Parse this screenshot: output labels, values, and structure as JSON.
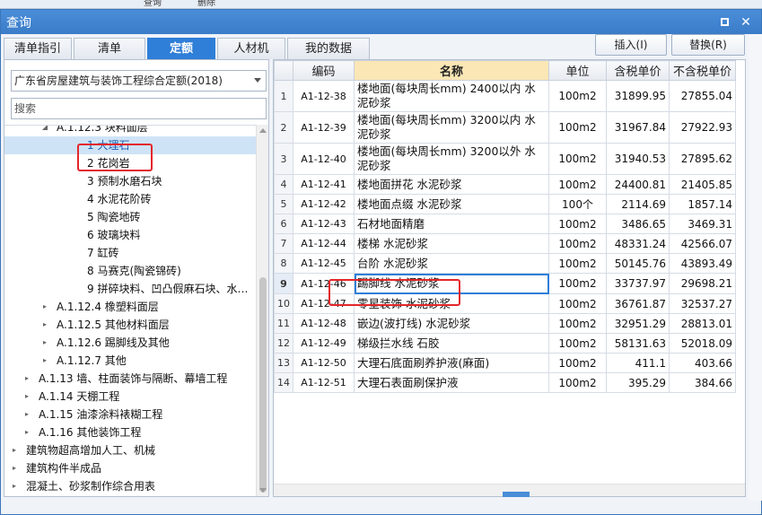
{
  "window": {
    "title": "查询"
  },
  "app_strip": {
    "items": [
      "查询",
      "删除"
    ]
  },
  "tabs": [
    {
      "label": "清单指引",
      "active": false
    },
    {
      "label": "清单",
      "active": false
    },
    {
      "label": "定额",
      "active": true
    },
    {
      "label": "人材机",
      "active": false
    },
    {
      "label": "我的数据",
      "active": false
    }
  ],
  "actions": {
    "insert_label": "插入(I)",
    "replace_label": "替换(R)"
  },
  "left": {
    "quota_library": "广东省房屋建筑与装饰工程综合定额(2018)",
    "search_placeholder": "搜索",
    "tree": [
      {
        "label": "A.1.12.3 块料面层",
        "level": 3,
        "expanded": true
      },
      {
        "label": "1 大理石",
        "level": 4,
        "selected": true
      },
      {
        "label": "2 花岗岩",
        "level": 4
      },
      {
        "label": "3 预制水磨石块",
        "level": 4
      },
      {
        "label": "4 水泥花阶砖",
        "level": 4
      },
      {
        "label": "5 陶瓷地砖",
        "level": 4
      },
      {
        "label": "6 玻璃块料",
        "level": 4
      },
      {
        "label": "7 缸砖",
        "level": 4
      },
      {
        "label": "8 马赛克(陶瓷锦砖)",
        "level": 4
      },
      {
        "label": "9 拼碎块料、凹凸假麻石块、水…",
        "level": 4
      },
      {
        "label": "A.1.12.4 橡塑料面层",
        "level": 3
      },
      {
        "label": "A.1.12.5 其他材料面层",
        "level": 3
      },
      {
        "label": "A.1.12.6 踢脚线及其他",
        "level": 3
      },
      {
        "label": "A.1.12.7 其他",
        "level": 3
      },
      {
        "label": "A.1.13 墙、柱面装饰与隔断、幕墙工程",
        "level": 2
      },
      {
        "label": "A.1.14 天棚工程",
        "level": 2
      },
      {
        "label": "A.1.15 油漆涂料裱糊工程",
        "level": 2
      },
      {
        "label": "A.1.16 其他装饰工程",
        "level": 2
      },
      {
        "label": "建筑物超高增加人工、机械",
        "level": 1
      },
      {
        "label": "建筑构件半成品",
        "level": 1
      },
      {
        "label": "混凝土、砂浆制作综合用表",
        "level": 1
      }
    ]
  },
  "grid": {
    "columns": {
      "code": "编码",
      "name": "名称",
      "unit": "单位",
      "price_tax": "含税单价",
      "price_notax": "不含税单价"
    },
    "rows": [
      {
        "idx": "1",
        "code": "A1-12-38",
        "name": "楼地面(每块周长mm) 2400以内 水泥砂浆",
        "unit": "100m2",
        "price_tax": "31899.95",
        "price_notax": "27855.04"
      },
      {
        "idx": "2",
        "code": "A1-12-39",
        "name": "楼地面(每块周长mm) 3200以内 水泥砂浆",
        "unit": "100m2",
        "price_tax": "31967.84",
        "price_notax": "27922.93"
      },
      {
        "idx": "3",
        "code": "A1-12-40",
        "name": "楼地面(每块周长mm) 3200以外 水泥砂浆",
        "unit": "100m2",
        "price_tax": "31940.53",
        "price_notax": "27895.62"
      },
      {
        "idx": "4",
        "code": "A1-12-41",
        "name": "楼地面拼花 水泥砂浆",
        "unit": "100m2",
        "price_tax": "24400.81",
        "price_notax": "21405.85"
      },
      {
        "idx": "5",
        "code": "A1-12-42",
        "name": "楼地面点缀 水泥砂浆",
        "unit": "100个",
        "price_tax": "2114.69",
        "price_notax": "1857.14"
      },
      {
        "idx": "6",
        "code": "A1-12-43",
        "name": "石材地面精磨",
        "unit": "100m2",
        "price_tax": "3486.65",
        "price_notax": "3469.31"
      },
      {
        "idx": "7",
        "code": "A1-12-44",
        "name": "楼梯 水泥砂浆",
        "unit": "100m2",
        "price_tax": "48331.24",
        "price_notax": "42566.07"
      },
      {
        "idx": "8",
        "code": "A1-12-45",
        "name": "台阶 水泥砂浆",
        "unit": "100m2",
        "price_tax": "50145.76",
        "price_notax": "43893.49"
      },
      {
        "idx": "9",
        "code": "A1-12-46",
        "name": "踢脚线 水泥砂浆",
        "unit": "100m2",
        "price_tax": "33737.97",
        "price_notax": "29698.21",
        "selected": true
      },
      {
        "idx": "10",
        "code": "A1-12-47",
        "name": "零星装饰 水泥砂浆",
        "unit": "100m2",
        "price_tax": "36761.87",
        "price_notax": "32537.27"
      },
      {
        "idx": "11",
        "code": "A1-12-48",
        "name": "嵌边(波打线) 水泥砂浆",
        "unit": "100m2",
        "price_tax": "32951.29",
        "price_notax": "28813.01"
      },
      {
        "idx": "12",
        "code": "A1-12-49",
        "name": "梯级拦水线 石胶",
        "unit": "100m2",
        "price_tax": "58131.63",
        "price_notax": "52018.09"
      },
      {
        "idx": "13",
        "code": "A1-12-50",
        "name": "大理石底面刷养护液(麻面)",
        "unit": "100m2",
        "price_tax": "411.1",
        "price_notax": "403.66"
      },
      {
        "idx": "14",
        "code": "A1-12-51",
        "name": "大理石表面刷保护液",
        "unit": "100m2",
        "price_tax": "395.29",
        "price_notax": "384.66"
      }
    ]
  },
  "colors": {
    "accent": "#2f7ed8",
    "title_bar": "#3b7cc9",
    "highlight_box": "#e3262b",
    "header_name": "#fbe7b5"
  }
}
